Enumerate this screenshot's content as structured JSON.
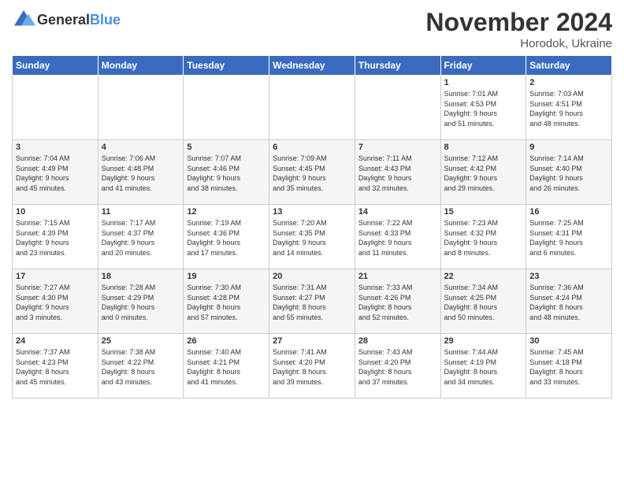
{
  "logo": {
    "text_general": "General",
    "text_blue": "Blue"
  },
  "title": "November 2024",
  "location": "Horodok, Ukraine",
  "weekdays": [
    "Sunday",
    "Monday",
    "Tuesday",
    "Wednesday",
    "Thursday",
    "Friday",
    "Saturday"
  ],
  "weeks": [
    [
      {
        "day": "",
        "info": ""
      },
      {
        "day": "",
        "info": ""
      },
      {
        "day": "",
        "info": ""
      },
      {
        "day": "",
        "info": ""
      },
      {
        "day": "",
        "info": ""
      },
      {
        "day": "1",
        "info": "Sunrise: 7:01 AM\nSunset: 4:53 PM\nDaylight: 9 hours\nand 51 minutes."
      },
      {
        "day": "2",
        "info": "Sunrise: 7:03 AM\nSunset: 4:51 PM\nDaylight: 9 hours\nand 48 minutes."
      }
    ],
    [
      {
        "day": "3",
        "info": "Sunrise: 7:04 AM\nSunset: 4:49 PM\nDaylight: 9 hours\nand 45 minutes."
      },
      {
        "day": "4",
        "info": "Sunrise: 7:06 AM\nSunset: 4:48 PM\nDaylight: 9 hours\nand 41 minutes."
      },
      {
        "day": "5",
        "info": "Sunrise: 7:07 AM\nSunset: 4:46 PM\nDaylight: 9 hours\nand 38 minutes."
      },
      {
        "day": "6",
        "info": "Sunrise: 7:09 AM\nSunset: 4:45 PM\nDaylight: 9 hours\nand 35 minutes."
      },
      {
        "day": "7",
        "info": "Sunrise: 7:11 AM\nSunset: 4:43 PM\nDaylight: 9 hours\nand 32 minutes."
      },
      {
        "day": "8",
        "info": "Sunrise: 7:12 AM\nSunset: 4:42 PM\nDaylight: 9 hours\nand 29 minutes."
      },
      {
        "day": "9",
        "info": "Sunrise: 7:14 AM\nSunset: 4:40 PM\nDaylight: 9 hours\nand 26 minutes."
      }
    ],
    [
      {
        "day": "10",
        "info": "Sunrise: 7:15 AM\nSunset: 4:39 PM\nDaylight: 9 hours\nand 23 minutes."
      },
      {
        "day": "11",
        "info": "Sunrise: 7:17 AM\nSunset: 4:37 PM\nDaylight: 9 hours\nand 20 minutes."
      },
      {
        "day": "12",
        "info": "Sunrise: 7:19 AM\nSunset: 4:36 PM\nDaylight: 9 hours\nand 17 minutes."
      },
      {
        "day": "13",
        "info": "Sunrise: 7:20 AM\nSunset: 4:35 PM\nDaylight: 9 hours\nand 14 minutes."
      },
      {
        "day": "14",
        "info": "Sunrise: 7:22 AM\nSunset: 4:33 PM\nDaylight: 9 hours\nand 11 minutes."
      },
      {
        "day": "15",
        "info": "Sunrise: 7:23 AM\nSunset: 4:32 PM\nDaylight: 9 hours\nand 8 minutes."
      },
      {
        "day": "16",
        "info": "Sunrise: 7:25 AM\nSunset: 4:31 PM\nDaylight: 9 hours\nand 6 minutes."
      }
    ],
    [
      {
        "day": "17",
        "info": "Sunrise: 7:27 AM\nSunset: 4:30 PM\nDaylight: 9 hours\nand 3 minutes."
      },
      {
        "day": "18",
        "info": "Sunrise: 7:28 AM\nSunset: 4:29 PM\nDaylight: 9 hours\nand 0 minutes."
      },
      {
        "day": "19",
        "info": "Sunrise: 7:30 AM\nSunset: 4:28 PM\nDaylight: 8 hours\nand 57 minutes."
      },
      {
        "day": "20",
        "info": "Sunrise: 7:31 AM\nSunset: 4:27 PM\nDaylight: 8 hours\nand 55 minutes."
      },
      {
        "day": "21",
        "info": "Sunrise: 7:33 AM\nSunset: 4:26 PM\nDaylight: 8 hours\nand 52 minutes."
      },
      {
        "day": "22",
        "info": "Sunrise: 7:34 AM\nSunset: 4:25 PM\nDaylight: 8 hours\nand 50 minutes."
      },
      {
        "day": "23",
        "info": "Sunrise: 7:36 AM\nSunset: 4:24 PM\nDaylight: 8 hours\nand 48 minutes."
      }
    ],
    [
      {
        "day": "24",
        "info": "Sunrise: 7:37 AM\nSunset: 4:23 PM\nDaylight: 8 hours\nand 45 minutes."
      },
      {
        "day": "25",
        "info": "Sunrise: 7:38 AM\nSunset: 4:22 PM\nDaylight: 8 hours\nand 43 minutes."
      },
      {
        "day": "26",
        "info": "Sunrise: 7:40 AM\nSunset: 4:21 PM\nDaylight: 8 hours\nand 41 minutes."
      },
      {
        "day": "27",
        "info": "Sunrise: 7:41 AM\nSunset: 4:20 PM\nDaylight: 8 hours\nand 39 minutes."
      },
      {
        "day": "28",
        "info": "Sunrise: 7:43 AM\nSunset: 4:20 PM\nDaylight: 8 hours\nand 37 minutes."
      },
      {
        "day": "29",
        "info": "Sunrise: 7:44 AM\nSunset: 4:19 PM\nDaylight: 8 hours\nand 34 minutes."
      },
      {
        "day": "30",
        "info": "Sunrise: 7:45 AM\nSunset: 4:18 PM\nDaylight: 8 hours\nand 33 minutes."
      }
    ]
  ]
}
